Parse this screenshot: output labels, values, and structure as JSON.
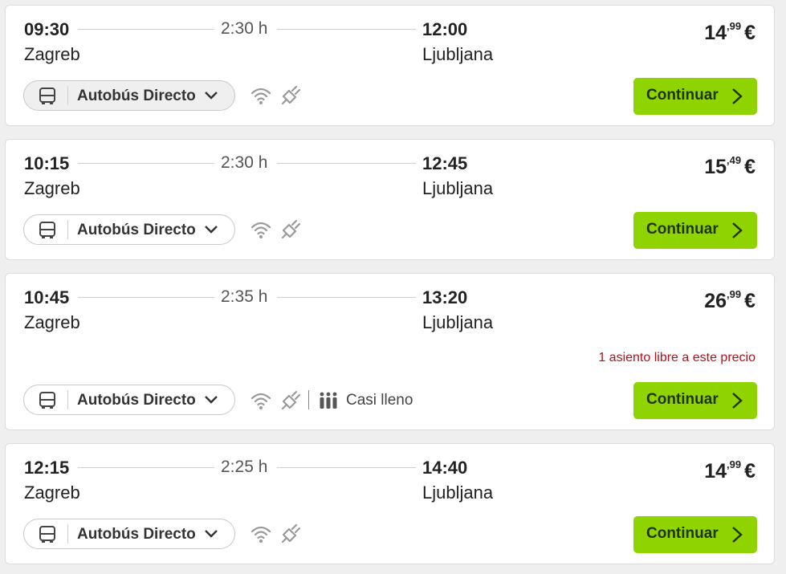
{
  "journeys": [
    {
      "departure_time": "09:30",
      "departure_city": "Zagreb",
      "duration": "2:30 h",
      "arrival_time": "12:00",
      "arrival_city": "Ljubljana",
      "price_int": "14",
      "price_cents": ",99",
      "currency": "€",
      "bus_type": "Autobús Directo",
      "amenities": [
        "wifi-icon",
        "plug-icon"
      ],
      "continue_label": "Continuar"
    },
    {
      "departure_time": "10:15",
      "departure_city": "Zagreb",
      "duration": "2:30 h",
      "arrival_time": "12:45",
      "arrival_city": "Ljubljana",
      "price_int": "15",
      "price_cents": ",49",
      "currency": "€",
      "bus_type": "Autobús Directo",
      "amenities": [
        "wifi-icon",
        "plug-icon"
      ],
      "continue_label": "Continuar"
    },
    {
      "departure_time": "10:45",
      "departure_city": "Zagreb",
      "duration": "2:35 h",
      "arrival_time": "13:20",
      "arrival_city": "Ljubljana",
      "price_int": "26",
      "price_cents": ",99",
      "currency": "€",
      "seat_warning": "1 asiento libre a este precio",
      "bus_type": "Autobús Directo",
      "amenities": [
        "wifi-icon",
        "plug-icon",
        "people-icon"
      ],
      "occupancy": "Casi lleno",
      "continue_label": "Continuar"
    },
    {
      "departure_time": "12:15",
      "departure_city": "Zagreb",
      "duration": "2:25 h",
      "arrival_time": "14:40",
      "arrival_city": "Ljubljana",
      "price_int": "14",
      "price_cents": ",99",
      "currency": "€",
      "bus_type": "Autobús Directo",
      "amenities": [
        "wifi-icon",
        "plug-icon"
      ],
      "continue_label": "Continuar"
    }
  ],
  "colors": {
    "accent_green": "#8fd400",
    "warning_red": "#b0121b"
  }
}
